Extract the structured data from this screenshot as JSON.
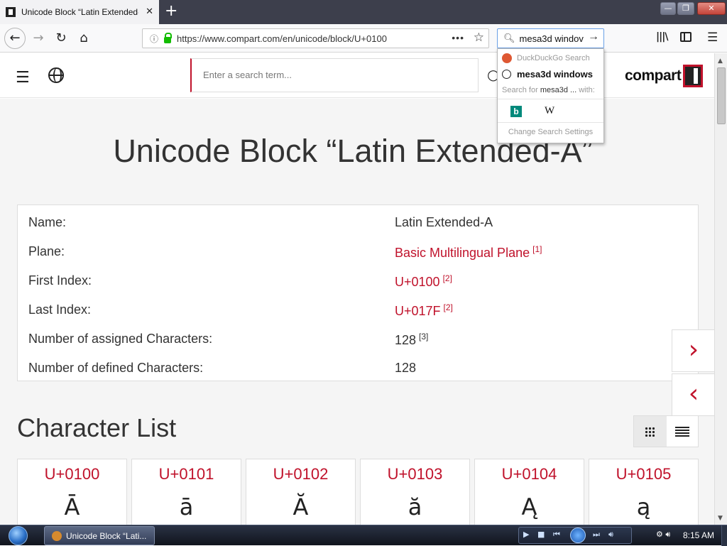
{
  "browser": {
    "tab_title": "Unicode Block “Latin Extended-A”",
    "tab_close": "✕",
    "new_tab": "+",
    "url": "https://www.compart.com/en/unicode/block/U+0100",
    "search_value": "mesa3d windov",
    "window_buttons": {
      "minimize": "—",
      "maximize": "❐",
      "close": "✕"
    }
  },
  "search_dropdown": {
    "engine_header": "DuckDuckGo Search",
    "history_item": "mesa3d windows",
    "search_for_prefix": "Search for ",
    "search_for_term": "mesa3d ...",
    "search_for_suffix": " with:",
    "engines": [
      "bing",
      "W"
    ],
    "settings": "Change Search Settings"
  },
  "site": {
    "search_placeholder": "Enter a search term...",
    "logo_text": "compart"
  },
  "page": {
    "title": "Unicode Block “Latin Extended-A”",
    "info": [
      {
        "key": "Name:",
        "value": "Latin Extended-A",
        "ref": ""
      },
      {
        "key": "Plane:",
        "value": "Basic Multilingual Plane",
        "ref": "[1]"
      },
      {
        "key": "First Index:",
        "value": "U+0100",
        "ref": "[2]"
      },
      {
        "key": "Last Index:",
        "value": "U+017F",
        "ref": "[2]"
      },
      {
        "key": "Number of assigned Characters:",
        "value": "128",
        "ref": "[3]"
      },
      {
        "key": "Number of defined Characters:",
        "value": "128",
        "ref": ""
      }
    ],
    "charlist_title": "Character List",
    "chars": [
      {
        "code": "U+0100",
        "glyph": "Ā"
      },
      {
        "code": "U+0101",
        "glyph": "ā"
      },
      {
        "code": "U+0102",
        "glyph": "Ă"
      },
      {
        "code": "U+0103",
        "glyph": "ă"
      },
      {
        "code": "U+0104",
        "glyph": "Ą"
      },
      {
        "code": "U+0105",
        "glyph": "ą"
      }
    ],
    "next_arrow": "›",
    "prev_arrow": "‹"
  },
  "taskbar": {
    "task_label": "Unicode Block “Lati...",
    "clock": "8:15 AM"
  },
  "colors": {
    "accent": "#c0122b",
    "tab_bar": "#3d3f4c"
  }
}
